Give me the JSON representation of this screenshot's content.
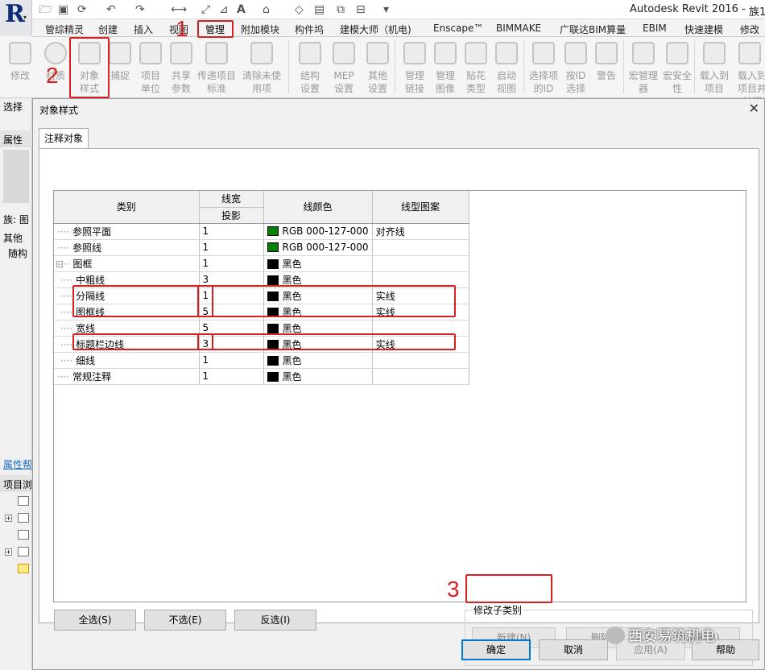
{
  "app": {
    "title": "Autodesk Revit 2016 -",
    "title_tail": "族1"
  },
  "ribbon_tabs": [
    "管综精灵",
    "创建",
    "插入",
    "视图",
    "管理",
    "附加模块",
    "构件坞",
    "建模大师（机电)",
    "Enscape™",
    "BIMMAKE",
    "广联达BIM算量",
    "EBIM",
    "快速建模",
    "修改"
  ],
  "ribbon_buttons": [
    {
      "label": "修改"
    },
    {
      "label": "材质"
    },
    {
      "label": "对象样式"
    },
    {
      "label": "捕捉"
    },
    {
      "label": "项目单位"
    },
    {
      "label": "共享参数"
    },
    {
      "label": "传递项目标准"
    },
    {
      "label": "清除未使用项"
    },
    {
      "label": "结构设置"
    },
    {
      "label": "MEP设置"
    },
    {
      "label": "其他设置"
    },
    {
      "label": "管理链接"
    },
    {
      "label": "管理图像"
    },
    {
      "label": "贴花类型"
    },
    {
      "label": "启动视图"
    },
    {
      "label": "选择项的ID"
    },
    {
      "label": "按ID选择"
    },
    {
      "label": "警告"
    },
    {
      "label": "宏管理器"
    },
    {
      "label": "宏安全性"
    },
    {
      "label": "载入到项目"
    },
    {
      "label": "载入到项目并关闭"
    }
  ],
  "left_panel": {
    "select_label": "选择",
    "properties": "属性",
    "family_label": "族: 图",
    "other": "其他",
    "param": "随构",
    "props_help": "属性帮",
    "project_browser": "项目浏"
  },
  "dialog": {
    "title": "对象样式",
    "close": "✕",
    "tab": "注释对象",
    "columns": {
      "category": "类别",
      "line_weight": "线宽",
      "projection": "投影",
      "line_color": "线颜色",
      "line_pattern": "线型图案"
    },
    "rows": [
      {
        "category": "参照平面",
        "indent": 0,
        "weight": "1",
        "color_name": "RGB 000-127-000",
        "color": "#008000",
        "pattern": "对齐线"
      },
      {
        "category": "参照线",
        "indent": 0,
        "weight": "1",
        "color_name": "RGB 000-127-000",
        "color": "#008000",
        "pattern": ""
      },
      {
        "category": "图框",
        "indent": 0,
        "weight": "1",
        "color_name": "黑色",
        "color": "#000000",
        "pattern": "",
        "expander": "⊟"
      },
      {
        "category": "中粗线",
        "indent": 1,
        "weight": "3",
        "color_name": "黑色",
        "color": "#000000",
        "pattern": ""
      },
      {
        "category": "分隔线",
        "indent": 1,
        "weight": "1",
        "color_name": "黑色",
        "color": "#000000",
        "pattern": "实线"
      },
      {
        "category": "图框线",
        "indent": 1,
        "weight": "5",
        "color_name": "黑色",
        "color": "#000000",
        "pattern": "实线"
      },
      {
        "category": "宽线",
        "indent": 1,
        "weight": "5",
        "color_name": "黑色",
        "color": "#000000",
        "pattern": ""
      },
      {
        "category": "标题栏边线",
        "indent": 1,
        "weight": "3",
        "color_name": "黑色",
        "color": "#000000",
        "pattern": "实线"
      },
      {
        "category": "细线",
        "indent": 1,
        "weight": "1",
        "color_name": "黑色",
        "color": "#000000",
        "pattern": ""
      },
      {
        "category": "常规注释",
        "indent": 0,
        "weight": "1",
        "color_name": "黑色",
        "color": "#000000",
        "pattern": ""
      }
    ],
    "select_all": "全选(S)",
    "select_none": "不选(E)",
    "invert": "反选(I)",
    "modify_subcategories": "修改子类别",
    "new": "新建(N)",
    "delete": "删除(D)",
    "rename": "重命名(R)",
    "ok": "确定",
    "cancel": "取消",
    "apply": "应用(A)",
    "help": "帮助"
  },
  "annotations": {
    "n1": "1",
    "n2": "2",
    "n3": "3"
  },
  "watermark": "西安易筑机电"
}
